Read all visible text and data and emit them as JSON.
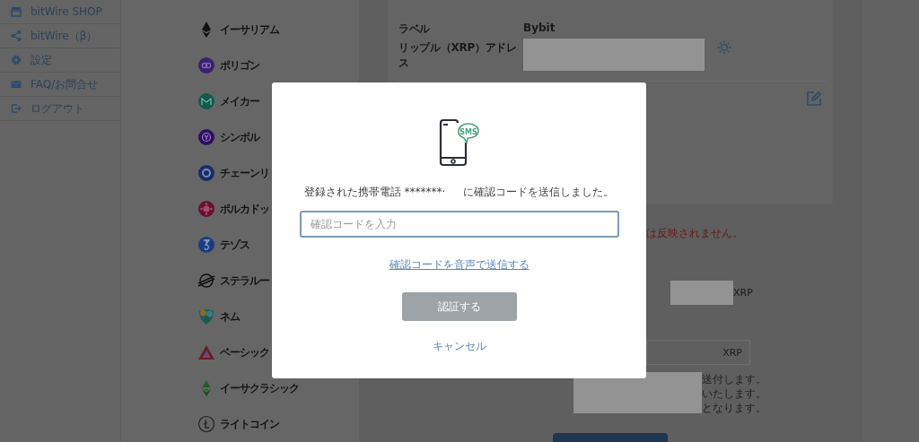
{
  "sidebar": {
    "items": [
      {
        "label": "bitWire SHOP",
        "kind": "shop"
      },
      {
        "label": "bitWire（β）",
        "kind": "share"
      },
      {
        "label": "設定",
        "kind": "settings"
      },
      {
        "label": "FAQ/お問合せ",
        "kind": "mail"
      },
      {
        "label": "ログアウト",
        "kind": "logout"
      }
    ]
  },
  "coins": [
    {
      "name": "イーサリアム",
      "kind": "ethereum"
    },
    {
      "name": "ポリゴン",
      "kind": "polygon"
    },
    {
      "name": "メイカー",
      "kind": "maker"
    },
    {
      "name": "シンボル",
      "kind": "symbol"
    },
    {
      "name": "チェーンリ",
      "kind": "chainlink"
    },
    {
      "name": "ポルカドッ",
      "kind": "polkadot"
    },
    {
      "name": "テゾス",
      "kind": "tezos"
    },
    {
      "name": "ステラルー",
      "kind": "stellar"
    },
    {
      "name": "ネム",
      "kind": "nem"
    },
    {
      "name": "ベーシック",
      "kind": "bat"
    },
    {
      "name": "イーサクラシック",
      "kind": "etc"
    },
    {
      "name": "ライトコイン",
      "kind": "litecoin"
    }
  ],
  "detail_card": {
    "rows": [
      {
        "label": "ラベル",
        "value": "Bybit"
      },
      {
        "label": "リップル（XRP）アドレス",
        "redacted": true
      }
    ]
  },
  "notice": "は反映されません。",
  "amount": {
    "unit": "XRP"
  },
  "amount_field": {
    "unit": "XRP"
  },
  "notes": [
    "送付します。",
    "いたします。",
    "となります。"
  ],
  "dialog": {
    "icon_text": "SMS",
    "message_before": "登録された携帯電話 *******·",
    "message_after": "に確認コードを送信しました。",
    "code_field": {
      "placeholder": "確認コードを入力"
    },
    "voice_link": "確認コードを音声で送信する",
    "submit": {
      "label": "認証する",
      "disabled": true
    },
    "cancel": "キャンセル"
  }
}
